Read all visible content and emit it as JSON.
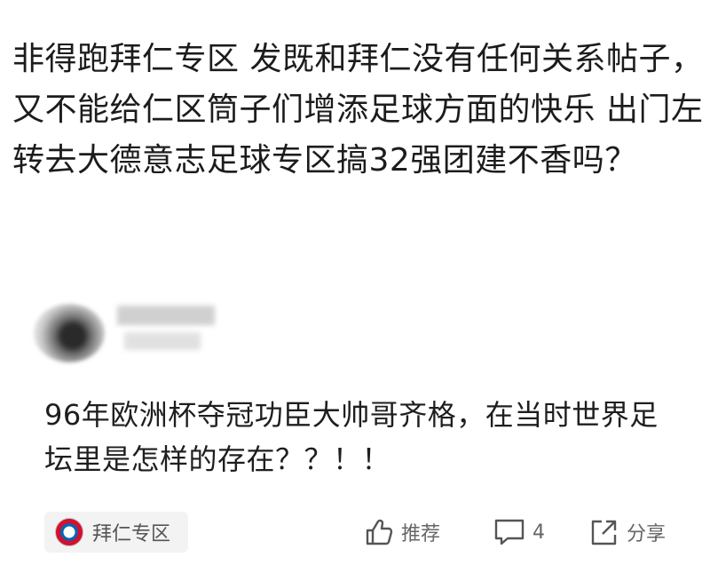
{
  "comment": {
    "text": "非得跑拜仁专区 发既和拜仁没有任何关系帖子，又不能给仁区筒子们增添足球方面的快乐 出门左转去大德意志足球专区搞32强团建不香吗？"
  },
  "post": {
    "title": "96年欧洲杯夺冠功臣大帅哥齐格，在当时世界足坛里是怎样的存在？？！！",
    "zone_label": "拜仁专区",
    "like_label": "推荐",
    "comment_count": "4",
    "share_label": "分享"
  },
  "icons": {
    "zone": "bayern-logo-icon",
    "like": "thumbs-up-icon",
    "comment": "comment-bubble-icon",
    "share": "share-arrow-icon"
  }
}
